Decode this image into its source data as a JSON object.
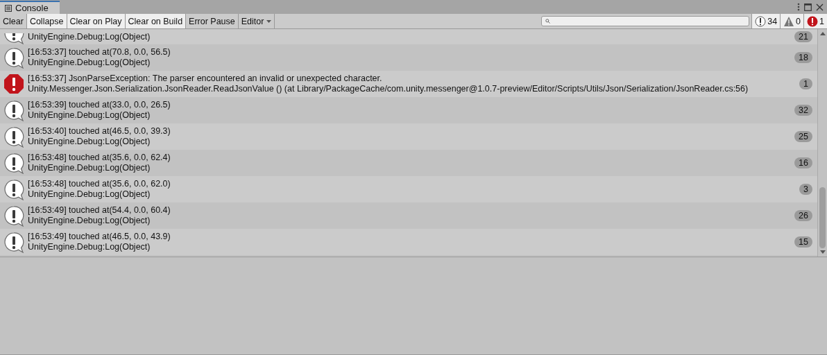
{
  "window": {
    "title": "Console"
  },
  "toolbar": {
    "buttons": [
      {
        "label": "Clear",
        "on": false
      },
      {
        "label": "Collapse",
        "on": true
      },
      {
        "label": "Clear on Play",
        "on": true
      },
      {
        "label": "Clear on Build",
        "on": true
      },
      {
        "label": "Error Pause",
        "on": false
      }
    ],
    "dropdown": {
      "label": "Editor"
    },
    "counters": [
      {
        "kind": "log",
        "count": "34",
        "on": true
      },
      {
        "kind": "warning",
        "count": "0",
        "on": true
      },
      {
        "kind": "error",
        "count": "1",
        "on": true
      }
    ]
  },
  "entries": [
    {
      "kind": "log",
      "partial": true,
      "lines": [
        "UnityEngine.Debug:Log(Object)"
      ],
      "count": "21"
    },
    {
      "kind": "log",
      "lines": [
        "[16:53:37] touched at(70.8, 0.0, 56.5)",
        "UnityEngine.Debug:Log(Object)"
      ],
      "count": "18"
    },
    {
      "kind": "error",
      "lines": [
        "[16:53:37] JsonParseException: The parser encountered an invalid or unexpected character.",
        "Unity.Messenger.Json.Serialization.JsonReader.ReadJsonValue () (at Library/PackageCache/com.unity.messenger@1.0.7-preview/Editor/Scripts/Utils/Json/Serialization/JsonReader.cs:56)"
      ],
      "count": "1"
    },
    {
      "kind": "log",
      "lines": [
        "[16:53:39] touched at(33.0, 0.0, 26.5)",
        "UnityEngine.Debug:Log(Object)"
      ],
      "count": "32"
    },
    {
      "kind": "log",
      "lines": [
        "[16:53:40] touched at(46.5, 0.0, 39.3)",
        "UnityEngine.Debug:Log(Object)"
      ],
      "count": "25"
    },
    {
      "kind": "log",
      "lines": [
        "[16:53:48] touched at(35.6, 0.0, 62.4)",
        "UnityEngine.Debug:Log(Object)"
      ],
      "count": "16"
    },
    {
      "kind": "log",
      "lines": [
        "[16:53:48] touched at(35.6, 0.0, 62.0)",
        "UnityEngine.Debug:Log(Object)"
      ],
      "count": "3"
    },
    {
      "kind": "log",
      "lines": [
        "[16:53:49] touched at(54.4, 0.0, 60.4)",
        "UnityEngine.Debug:Log(Object)"
      ],
      "count": "26"
    },
    {
      "kind": "log",
      "lines": [
        "[16:53:49] touched at(46.5, 0.0, 43.9)",
        "UnityEngine.Debug:Log(Object)"
      ],
      "count": "15"
    }
  ]
}
